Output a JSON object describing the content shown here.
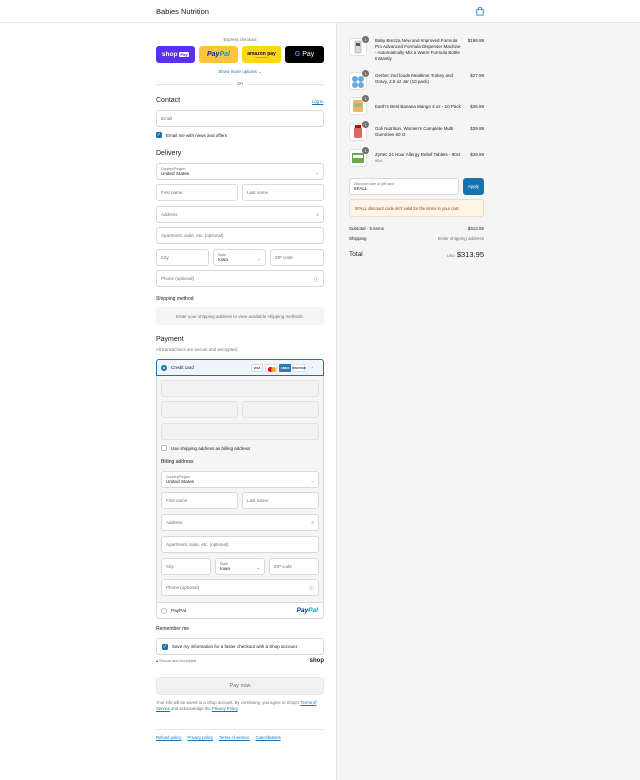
{
  "header": {
    "brand": "Babies Nutrition",
    "cart_icon": "shopping-bag-icon"
  },
  "express": {
    "label": "Express checkout",
    "shop_pay": {
      "text": "shop",
      "badge": "Pay"
    },
    "paypal": {
      "text_1": "Pay",
      "text_2": "Pal"
    },
    "amazon": {
      "text": "amazon pay"
    },
    "gpay": {
      "g": "G",
      "text": "Pay"
    },
    "more_options": "Show more options ⌄",
    "or": "OR"
  },
  "contact": {
    "title": "Contact",
    "login": "Log in",
    "email_placeholder": "Email",
    "news_checkbox": "Email me with news and offers"
  },
  "delivery": {
    "title": "Delivery",
    "country_label": "Country/Region",
    "country_value": "United States",
    "first_name": "First name",
    "last_name": "Last name",
    "address": "Address",
    "apartment": "Apartment, suite, etc. (optional)",
    "city": "City",
    "state_label": "State",
    "state_value": "Iowa",
    "zip": "ZIP code",
    "phone": "Phone (optional)"
  },
  "shipping_method": {
    "title": "Shipping method",
    "notice": "Enter your shipping address to view available shipping methods."
  },
  "payment": {
    "title": "Payment",
    "subtitle": "All transactions are secure and encrypted.",
    "credit_card_label": "Credit card",
    "cards": [
      "VISA",
      "mastercard",
      "AMEX",
      "DISCOVER"
    ],
    "more_cards": "→",
    "use_shipping_as_billing": "Use shipping address as billing address",
    "billing_title": "Billing address",
    "billing": {
      "country_label": "Country/Region",
      "country_value": "United States",
      "first_name": "First name",
      "last_name": "Last name",
      "address": "Address",
      "apartment": "Apartment, suite, etc. (optional)",
      "city": "City",
      "state_label": "State",
      "state_value": "Iowa",
      "zip": "ZIP code",
      "phone": "Phone (optional)"
    },
    "paypal_label": "PayPal",
    "paypal_logo_1": "Pay",
    "paypal_logo_2": "Pal"
  },
  "remember": {
    "title": "Remember me",
    "checkbox": "Save my information for a faster checkout with a Shop account",
    "secure": "Secure and encrypted",
    "shop_word": "shop"
  },
  "pay_now": "Pay now",
  "legal": {
    "text_1": "Your info will be saved to a Shop account. By continuing, you agree to Shop's",
    "terms": "Terms of Service",
    "text_2": "and acknowledge the",
    "privacy": "Privacy Policy",
    "text_3": "."
  },
  "footer": [
    "Refund policy",
    "Privacy policy",
    "Terms of service",
    "Cancellations"
  ],
  "order": {
    "items": [
      {
        "name": "Baby Brezza New and Improved Formula Pro Advanced Formula Dispenser Machine - Automatically Mix a Warm Formula Bottle Instantly",
        "sub": "",
        "price": "$199.99",
        "qty": "1"
      },
      {
        "name": "Gerber 2nd foods Mealtime Turkey and Gravy, 2.5 oz Jar (10 pack)",
        "sub": "",
        "price": "$27.99",
        "qty": "1"
      },
      {
        "name": "Earth's Best Banana Mango 4 oz - 10 Pack",
        "sub": "",
        "price": "$25.99",
        "qty": "1"
      },
      {
        "name": "Goli Nutrition, Women's Complete Multi Gummies 60 ct",
        "sub": "",
        "price": "$29.99",
        "qty": "1"
      },
      {
        "name": "Zyrtec 24 Hour Allergy Relief Tablets - 90ct",
        "sub": "90ct",
        "price": "$29.99",
        "qty": "1"
      }
    ],
    "discount_label": "Discount code or gift card",
    "discount_value": "5FALL",
    "apply": "Apply",
    "discount_error": "5FALL discount code isn't valid for the items in your cart.",
    "subtotal_label": "Subtotal · 5 items",
    "subtotal_value": "$313.95",
    "shipping_label": "Shipping",
    "shipping_value": "Enter shipping address",
    "total_label": "Total",
    "currency": "USD",
    "total_value": "$313.95"
  }
}
